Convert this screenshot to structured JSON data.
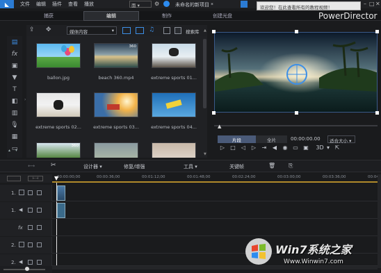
{
  "menubar": {
    "items": [
      "文件",
      "编辑",
      "插件",
      "查看",
      "播放"
    ],
    "view_selector": "面",
    "project_title": "未命名的新项目 *",
    "notification": "欢迎您！在此查看所有的教程视频！"
  },
  "mode_tabs": [
    "捕获",
    "编辑",
    "制作",
    "创建光盘"
  ],
  "brand": "PowerDirector",
  "library": {
    "category": "媒体内容",
    "search": "搜索库",
    "items": [
      {
        "caption": "ballon.jpg",
        "badge": ""
      },
      {
        "caption": "beach 360.mp4",
        "badge": "360"
      },
      {
        "caption": "extreme sports 01...",
        "badge": ""
      },
      {
        "caption": "extreme sports 02...",
        "badge": ""
      },
      {
        "caption": "extreme sports 03...",
        "badge": ""
      },
      {
        "caption": "extreme sports 04...",
        "badge": ""
      },
      {
        "caption": "",
        "badge": "360"
      },
      {
        "caption": "",
        "badge": ""
      },
      {
        "caption": "",
        "badge": ""
      }
    ]
  },
  "preview": {
    "clip_label": "片段",
    "all_label": "全片",
    "timecode": "00:00:00.00",
    "fit_label": "适合大小",
    "mode_3d": "3D"
  },
  "timeline_toolbar": {
    "designer": "设计器",
    "fix_enhance": "修复/增强",
    "tools": "工具",
    "keyframe": "关键帧"
  },
  "ruler": [
    "00:00:00;00",
    "00:00:36;00",
    "00:01:12;00",
    "00:01:48;00",
    "00:02:24;00",
    "00:03:00;00",
    "00:03:36;00",
    "00:04:12;00"
  ],
  "tracks": [
    {
      "label": "1."
    },
    {
      "label": "1."
    },
    {
      "label": "fx"
    },
    {
      "label": "2."
    },
    {
      "label": "2."
    }
  ],
  "watermark": {
    "brand": "Win7系统之家",
    "url": "Www.Winwin7.com"
  }
}
